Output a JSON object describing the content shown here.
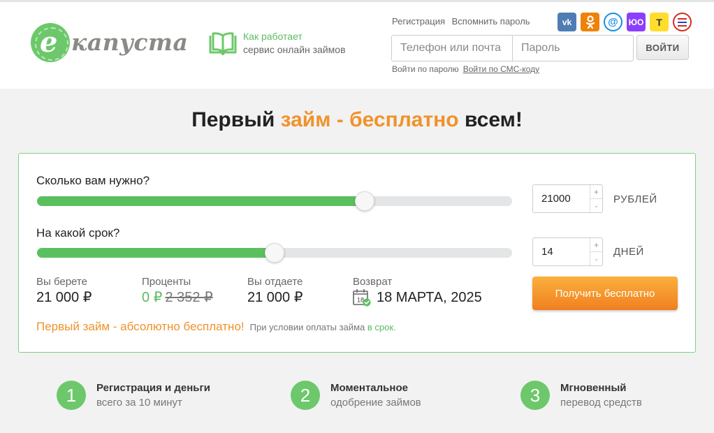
{
  "header": {
    "logo_text": "капуста",
    "logo_letter": "e",
    "how": {
      "line1": "Как работает",
      "line2": "сервис онлайн займов"
    },
    "auth_links": [
      "Регистрация",
      "Вспомнить пароль"
    ],
    "socials": [
      {
        "name": "vk",
        "label": "vk"
      },
      {
        "name": "odnoklassniki",
        "label": "ok"
      },
      {
        "name": "mail-ru",
        "label": "@"
      },
      {
        "name": "yumoney",
        "label": "ЮО"
      },
      {
        "name": "tinkoff",
        "label": "Т"
      },
      {
        "name": "gosuslugi",
        "label": ""
      }
    ],
    "login": {
      "phone_placeholder": "Телефон или почта",
      "password_placeholder": "Пароль",
      "submit_label": "ВОЙТИ",
      "by_password": "Войти по паролю",
      "by_sms": "Войти по СМС-коду"
    }
  },
  "hero": {
    "part1": "Первый",
    "accent": "займ - бесплатно",
    "part2": "всем!"
  },
  "calculator": {
    "amount": {
      "question": "Сколько вам нужно?",
      "value": "21000",
      "unit": "РУБЛЕЙ",
      "fraction": 0.69
    },
    "term": {
      "question": "На какой срок?",
      "value": "14",
      "unit": "ДНЕЙ",
      "fraction": 0.5
    },
    "summary": {
      "take_label": "Вы берете",
      "take_value": "21 000 ₽",
      "interest_label": "Проценты",
      "interest_value": "0 ₽",
      "interest_old": "2 352 ₽",
      "give_label": "Вы отдаете",
      "give_value": "21 000 ₽",
      "return_label": "Возврат",
      "return_date": "18 МАРТА, 2025",
      "calendar_day": "18"
    },
    "cta_label": "Получить бесплатно",
    "promo_main": "Первый займ - абсолютно бесплатно!",
    "promo_sub": "При условии оплаты займа",
    "promo_sub_accent": "в срок."
  },
  "features": [
    {
      "num": "1",
      "title": "Регистрация и деньги",
      "sub": "всего за 10 минут"
    },
    {
      "num": "2",
      "title": "Моментальное",
      "sub": "одобрение займов"
    },
    {
      "num": "3",
      "title": "Мгновенный",
      "sub": "перевод средств"
    }
  ],
  "colors": {
    "green": "#5ac05f",
    "orange": "#f0922b",
    "track": "#e3e5e6"
  }
}
